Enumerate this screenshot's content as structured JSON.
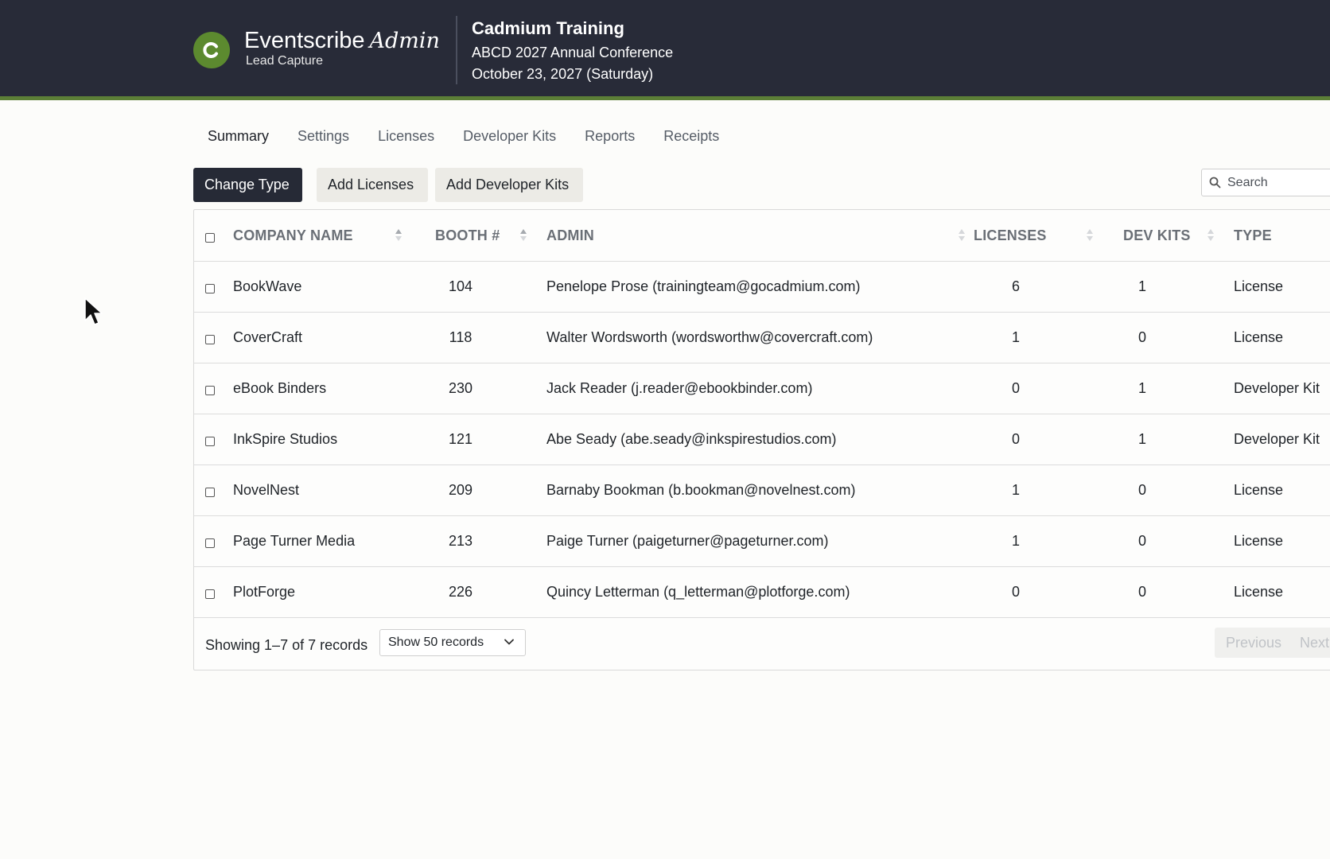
{
  "header": {
    "brand": "Eventscribe",
    "brand_suffix": "Admin",
    "brand_sub": "Lead Capture",
    "logo_letter": "C",
    "event_title": "Cadmium Training",
    "event_name": "ABCD 2027 Annual Conference",
    "event_date": "October 23, 2027 (Saturday)"
  },
  "tabs": [
    {
      "label": "Summary",
      "active": true
    },
    {
      "label": "Settings"
    },
    {
      "label": "Licenses"
    },
    {
      "label": "Developer Kits"
    },
    {
      "label": "Reports"
    },
    {
      "label": "Receipts"
    }
  ],
  "toolbar": {
    "change_type": "Change Type",
    "add_licenses": "Add Licenses",
    "add_dev_kits": "Add Developer Kits",
    "search_placeholder": "Search"
  },
  "table": {
    "columns": [
      "COMPANY NAME",
      "BOOTH #",
      "ADMIN",
      "LICENSES",
      "DEV KITS",
      "TYPE"
    ],
    "rows": [
      {
        "company": "BookWave",
        "booth": "104",
        "admin": "Penelope Prose (trainingteam@gocadmium.com)",
        "licenses": "6",
        "dev_kits": "1",
        "type": "License"
      },
      {
        "company": "CoverCraft",
        "booth": "118",
        "admin": "Walter Wordsworth (wordsworthw@covercraft.com)",
        "licenses": "1",
        "dev_kits": "0",
        "type": "License"
      },
      {
        "company": "eBook Binders",
        "booth": "230",
        "admin": "Jack Reader (j.reader@ebookbinder.com)",
        "licenses": "0",
        "dev_kits": "1",
        "type": "Developer Kit"
      },
      {
        "company": "InkSpire Studios",
        "booth": "121",
        "admin": "Abe Seady (abe.seady@inkspirestudios.com)",
        "licenses": "0",
        "dev_kits": "1",
        "type": "Developer Kit"
      },
      {
        "company": "NovelNest",
        "booth": "209",
        "admin": "Barnaby Bookman (b.bookman@novelnest.com)",
        "licenses": "1",
        "dev_kits": "0",
        "type": "License"
      },
      {
        "company": "Page Turner Media",
        "booth": "213",
        "admin": "Paige Turner (paigeturner@pageturner.com)",
        "licenses": "1",
        "dev_kits": "0",
        "type": "License"
      },
      {
        "company": "PlotForge",
        "booth": "226",
        "admin": "Quincy Letterman (q_letterman@plotforge.com)",
        "licenses": "0",
        "dev_kits": "0",
        "type": "License"
      }
    ]
  },
  "footer": {
    "showing": "Showing 1–7 of 7 records",
    "page_size": "Show 50 records",
    "previous": "Previous",
    "next": "Next"
  },
  "colors": {
    "header_bg": "#282b38",
    "accent_green": "#5c8a2f",
    "primary_button": "#262a36"
  }
}
